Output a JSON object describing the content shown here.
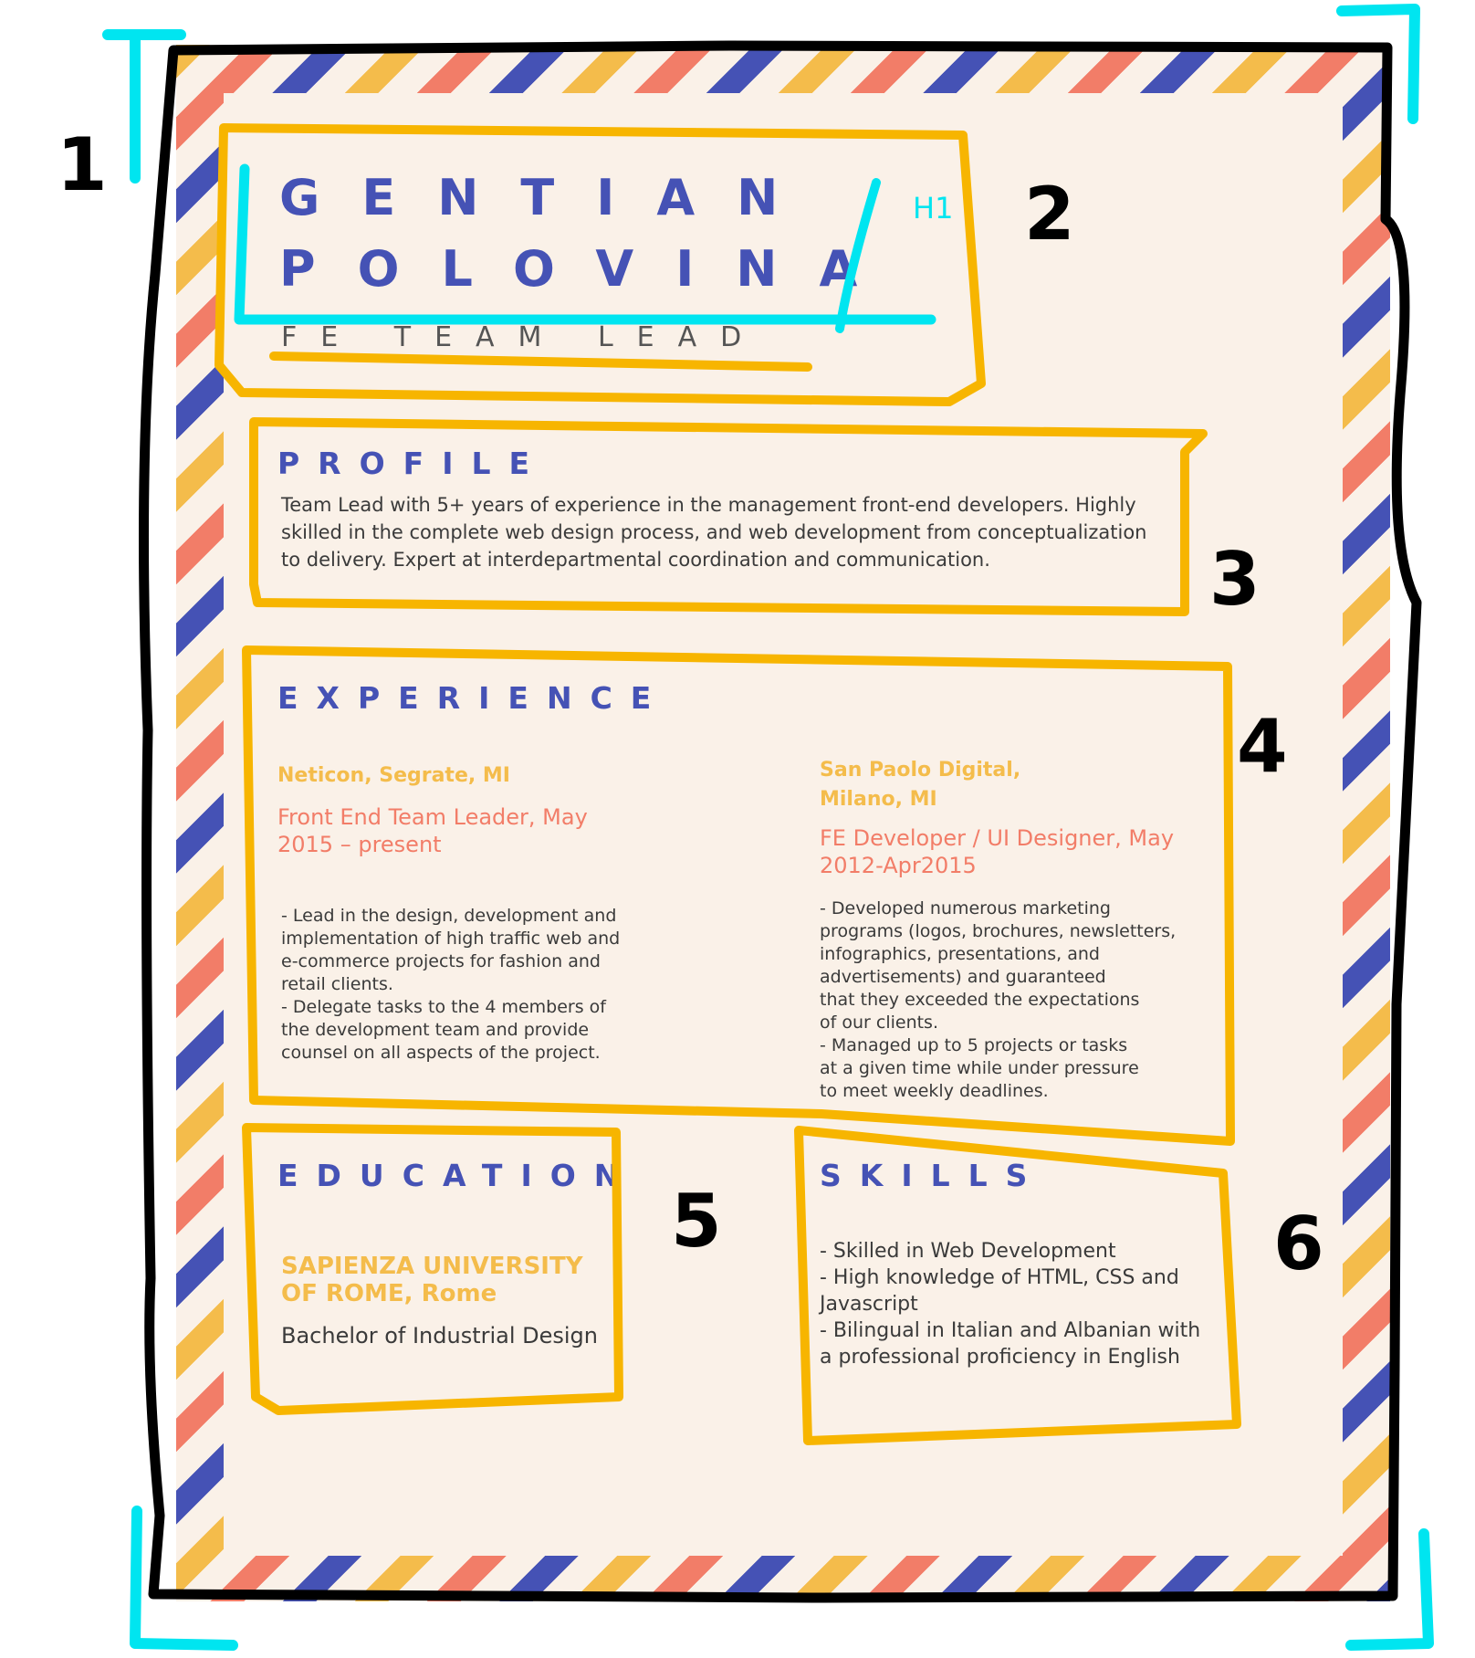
{
  "colors": {
    "navy": "#4552b5",
    "mustard": "#f4bc4b",
    "coral": "#f27d68",
    "paper": "#faf1e8",
    "highlight": "#f7b500",
    "marker": "#00e5f0"
  },
  "header": {
    "first_name": "GENTIAN",
    "last_name": "POLOVINA",
    "title": "FE TEAM LEAD",
    "tag": "H1"
  },
  "profile": {
    "heading": "PROFILE",
    "text": "Team Lead with 5+ years of experience in the management front-end developers. Highly\nskilled in the complete web design process, and web development from conceptualization\nto delivery. Expert at interdepartmental coordination and communication."
  },
  "experience": {
    "heading": "EXPERIENCE",
    "jobs": [
      {
        "company": "Neticon, Segrate, MI",
        "role": "Front End Team Leader, May\n2015 – present",
        "details": "- Lead in the design, development and\nimplementation of high traffic web and\ne-commerce projects for fashion and\nretail clients.\n- Delegate tasks to the 4 members of\nthe development team and provide\ncounsel on all aspects of the project."
      },
      {
        "company": "San Paolo Digital,\nMilano, MI",
        "role": "FE Developer / UI Designer, May\n2012-Apr2015",
        "details": "- Developed numerous marketing\nprograms (logos, brochures, newsletters,\ninfographics, presentations, and\nadvertisements) and guaranteed\nthat they exceeded the expectations\nof our clients.\n- Managed up to 5 projects or tasks\nat a given time while under pressure\nto meet weekly deadlines."
      }
    ]
  },
  "education": {
    "heading": "EDUCATION",
    "school": "SAPIENZA UNIVERSITY\nOF ROME, Rome",
    "degree": "Bachelor of Industrial Design"
  },
  "skills": {
    "heading": "SKILLS",
    "text": "- Skilled in Web Development\n- High knowledge of HTML, CSS and\nJavascript\n- Bilingual in Italian and Albanian with\na professional proficiency in English"
  },
  "annotations": {
    "labels": [
      "1",
      "2",
      "3",
      "4",
      "5",
      "6"
    ]
  }
}
